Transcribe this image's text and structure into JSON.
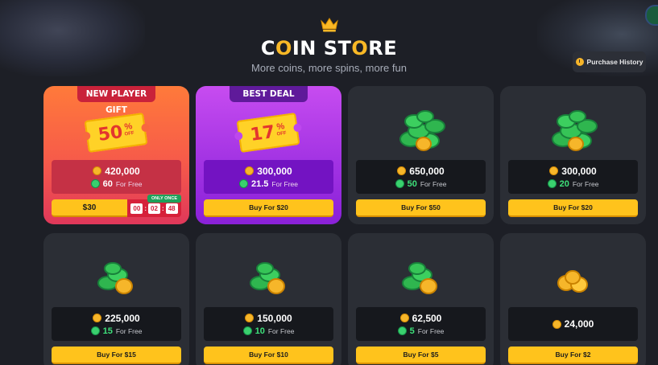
{
  "header": {
    "title_pre": "C",
    "title_o": "O",
    "title_mid": "IN ST",
    "title_o2": "O",
    "title_post": "RE",
    "subtitle": "More coins, more spins, more fun"
  },
  "history_button": {
    "label": "Purchase History",
    "icon": "clock-icon"
  },
  "colors": {
    "background": "#1d1f26",
    "card": "#2b2e35",
    "buy_button": "#ffc31c",
    "gold_coin": "#f6b62a",
    "sweep_coin": "#3ad06e",
    "promo_orange": "#ff7a3a",
    "promo_purple": "#c74cf0"
  },
  "promo_cards": [
    {
      "ribbon": "NEW PLAYER GIFT",
      "discount_value": "50",
      "discount_sign": "%",
      "discount_off": "OFF",
      "coins": "420,000",
      "free_amount": "60",
      "free_label": "For Free",
      "price": "$30",
      "badge": "ONLY ONCE",
      "timer": {
        "h": "00",
        "m": "02",
        "s": "48"
      }
    },
    {
      "ribbon": "BEST DEAL",
      "discount_value": "17",
      "discount_sign": "%",
      "discount_off": "OFF",
      "coins": "300,000",
      "free_amount": "21.5",
      "free_label": "For Free",
      "button": "Buy For $20"
    }
  ],
  "packs": [
    {
      "coins": "650,000",
      "free_amount": "50",
      "free_label": "For Free",
      "button": "Buy For $50",
      "icon": "green-coin-pile-icon"
    },
    {
      "coins": "300,000",
      "free_amount": "20",
      "free_label": "For Free",
      "button": "Buy For $20",
      "icon": "green-coin-pile-icon"
    },
    {
      "coins": "225,000",
      "free_amount": "15",
      "free_label": "For Free",
      "button": "Buy For $15",
      "icon": "green-coin-pile-icon"
    },
    {
      "coins": "150,000",
      "free_amount": "10",
      "free_label": "For Free",
      "button": "Buy For $10",
      "icon": "green-coin-pile-icon"
    },
    {
      "coins": "62,500",
      "free_amount": "5",
      "free_label": "For Free",
      "button": "Buy For $5",
      "icon": "green-coin-pile-icon"
    },
    {
      "coins": "24,000",
      "button": "Buy For $2",
      "icon": "gold-coin-pile-icon"
    }
  ]
}
